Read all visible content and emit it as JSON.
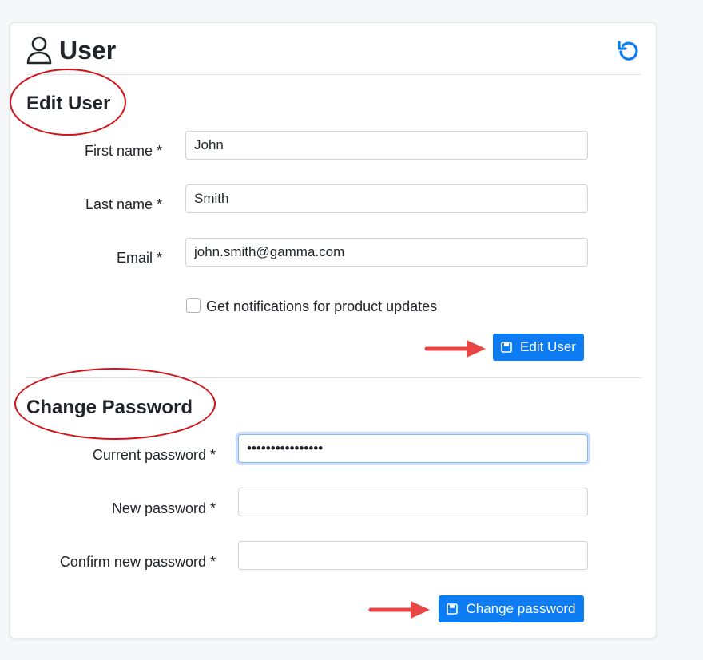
{
  "header": {
    "title": "User"
  },
  "edit_user": {
    "title": "Edit User",
    "first_name": {
      "label": "First name *",
      "value": "John"
    },
    "last_name": {
      "label": "Last name *",
      "value": "Smith"
    },
    "email": {
      "label": "Email *",
      "value": "john.smith@gamma.com"
    },
    "notifications": {
      "label": "Get notifications for product updates",
      "checked": false
    },
    "submit_label": "Edit User"
  },
  "change_password": {
    "title": "Change Password",
    "current": {
      "label": "Current password *",
      "value": "••••••••••••••••"
    },
    "new": {
      "label": "New password *",
      "value": ""
    },
    "confirm": {
      "label": "Confirm new password *",
      "value": ""
    },
    "submit_label": "Change password"
  },
  "colors": {
    "accent": "#0d7bf2",
    "annotation": "#d3121a",
    "arrow": "#e84545"
  }
}
